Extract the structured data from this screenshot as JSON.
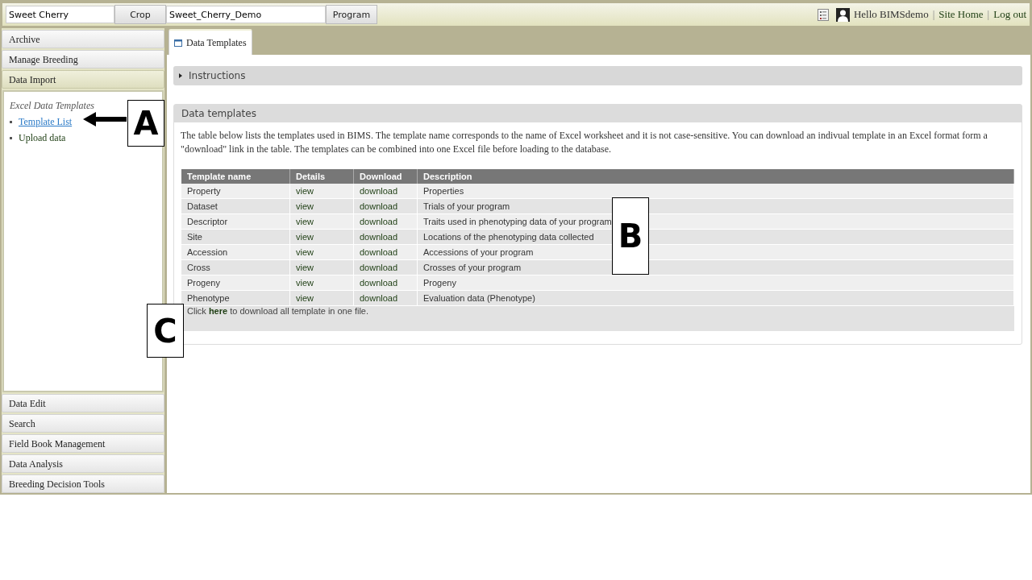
{
  "topbar": {
    "crop_field": {
      "value": "Sweet Cherry"
    },
    "crop_button": "Crop",
    "program_field": {
      "value": "Sweet_Cherry_Demo"
    },
    "program_button": "Program",
    "greeting": "Hello BIMSdemo",
    "separator_1": "|",
    "site_home": "Site Home",
    "separator_2": "|",
    "logout": "Log out"
  },
  "sidebar": {
    "sections": [
      {
        "label": "Archive",
        "expanded": false
      },
      {
        "label": "Manage Breeding",
        "expanded": false
      },
      {
        "label": "Data Import",
        "expanded": true,
        "heading": "Excel Data Templates",
        "items": [
          {
            "label": "Template List",
            "selected": true
          },
          {
            "label": "Upload data",
            "selected": false
          }
        ]
      },
      {
        "label": "Data Edit",
        "expanded": false
      },
      {
        "label": "Search",
        "expanded": false
      },
      {
        "label": "Field Book Management",
        "expanded": false
      },
      {
        "label": "Data Analysis",
        "expanded": false
      },
      {
        "label": "Breeding Decision Tools",
        "expanded": false
      }
    ]
  },
  "tabs": [
    {
      "label": "Data Templates",
      "selected": true
    }
  ],
  "instructions": {
    "label": "Instructions",
    "expanded": false
  },
  "panel": {
    "title": "Data templates",
    "description": "The table below lists the templates used in BIMS. The template name corresponds to the name of Excel worksheet and it is not case-sensitive. You can download an indivual template in an Excel format form a \"download\" link in the table. The templates can be combined into one Excel file before loading to the database.",
    "table": {
      "columns": [
        "Template name",
        "Details",
        "Download",
        "Description"
      ],
      "rows": [
        [
          "Property",
          "view",
          "download",
          "Properties"
        ],
        [
          "Dataset",
          "view",
          "download",
          "Trials of your program"
        ],
        [
          "Descriptor",
          "view",
          "download",
          "Traits used in phenotyping data of your program"
        ],
        [
          "Site",
          "view",
          "download",
          "Locations of the phenotyping data collected"
        ],
        [
          "Accession",
          "view",
          "download",
          "Accessions of your program"
        ],
        [
          "Cross",
          "view",
          "download",
          "Crosses of your program"
        ],
        [
          "Progeny",
          "view",
          "download",
          "Progeny"
        ],
        [
          "Phenotype",
          "view",
          "download",
          "Evaluation data (Phenotype)"
        ]
      ]
    },
    "footer": {
      "before": "Click",
      "link": "here",
      "after": "to download all template in one file."
    }
  },
  "callouts": [
    {
      "label": "A",
      "arrow": true
    },
    {
      "label": "B",
      "arrow": false
    },
    {
      "label": "C",
      "arrow": false
    }
  ]
}
